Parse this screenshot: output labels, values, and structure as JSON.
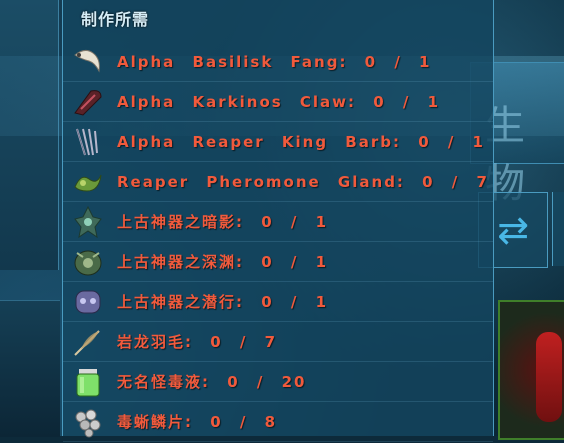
{
  "panel": {
    "title": "制作所需"
  },
  "background": {
    "header_text": "生物"
  },
  "requirements": [
    {
      "label": "Alpha  Basilisk  Fang:  0  /  1",
      "icon": "fang-icon",
      "color": "#f15a3c"
    },
    {
      "label": "Alpha  Karkinos  Claw:  0  /  1",
      "icon": "claw-icon",
      "color": "#f15a3c"
    },
    {
      "label": "Alpha  Reaper  King  Barb:  0  /  1",
      "icon": "barb-icon",
      "color": "#f15a3c"
    },
    {
      "label": "Reaper  Pheromone  Gland:  0  /  7",
      "icon": "gland-icon",
      "color": "#f15a3c"
    },
    {
      "label": "上古神器之暗影:  0  /  1",
      "icon": "artifact-shadow-icon",
      "color": "#f15a3c"
    },
    {
      "label": "上古神器之深渊:  0  /  1",
      "icon": "artifact-depths-icon",
      "color": "#f15a3c"
    },
    {
      "label": "上古神器之潜行:  0  /  1",
      "icon": "artifact-stalker-icon",
      "color": "#f15a3c"
    },
    {
      "label": "岩龙羽毛:  0  /  7",
      "icon": "feather-icon",
      "color": "#f15a3c"
    },
    {
      "label": "无名怪毒液:  0  /  20",
      "icon": "venom-jar-icon",
      "color": "#f15a3c"
    },
    {
      "label": "毒蜥鳞片:  0  /  8",
      "icon": "scales-icon",
      "color": "#f15a3c"
    }
  ]
}
